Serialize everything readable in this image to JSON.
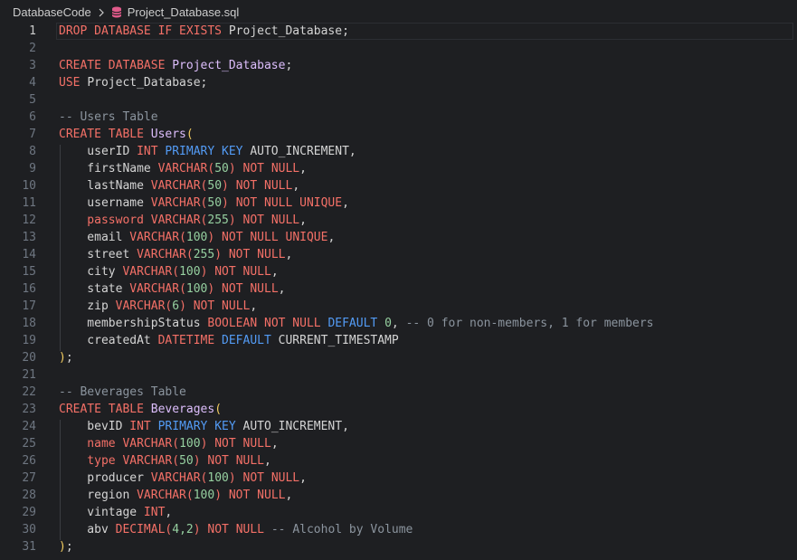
{
  "breadcrumb": {
    "folder": "DatabaseCode",
    "file": "Project_Database.sql",
    "file_icon": "database-icon",
    "separator_icon": "chevron-right-icon"
  },
  "editor": {
    "current_line": 1,
    "lines": [
      {
        "n": "1",
        "t": [
          [
            "kw",
            "DROP DATABASE IF EXISTS "
          ],
          [
            "pl",
            "Project_Database;"
          ]
        ]
      },
      {
        "n": "2",
        "t": []
      },
      {
        "n": "3",
        "t": [
          [
            "kw",
            "CREATE DATABASE "
          ],
          [
            "id",
            "Project_Database"
          ],
          [
            "pl",
            ";"
          ]
        ]
      },
      {
        "n": "4",
        "t": [
          [
            "kw",
            "USE "
          ],
          [
            "pl",
            "Project_Database;"
          ]
        ]
      },
      {
        "n": "5",
        "t": []
      },
      {
        "n": "6",
        "t": [
          [
            "cm",
            "-- Users Table"
          ]
        ]
      },
      {
        "n": "7",
        "t": [
          [
            "kw",
            "CREATE TABLE "
          ],
          [
            "id",
            "Users"
          ],
          [
            "pu",
            "("
          ]
        ]
      },
      {
        "n": "8",
        "t": [
          [
            "pl",
            "    userID "
          ],
          [
            "ty",
            "INT "
          ],
          [
            "bl",
            "PRIMARY KEY "
          ],
          [
            "pl",
            "AUTO_INCREMENT,"
          ]
        ]
      },
      {
        "n": "9",
        "t": [
          [
            "pl",
            "    firstName "
          ],
          [
            "ty",
            "VARCHAR("
          ],
          [
            "nm",
            "50"
          ],
          [
            "ty",
            ") "
          ],
          [
            "kw",
            "NOT NULL"
          ],
          [
            "pl",
            ","
          ]
        ]
      },
      {
        "n": "10",
        "t": [
          [
            "pl",
            "    lastName "
          ],
          [
            "ty",
            "VARCHAR("
          ],
          [
            "nm",
            "50"
          ],
          [
            "ty",
            ") "
          ],
          [
            "kw",
            "NOT NULL"
          ],
          [
            "pl",
            ","
          ]
        ]
      },
      {
        "n": "11",
        "t": [
          [
            "pl",
            "    username "
          ],
          [
            "ty",
            "VARCHAR("
          ],
          [
            "nm",
            "50"
          ],
          [
            "ty",
            ") "
          ],
          [
            "kw",
            "NOT NULL UNIQUE"
          ],
          [
            "pl",
            ","
          ]
        ]
      },
      {
        "n": "12",
        "t": [
          [
            "kw",
            "    password "
          ],
          [
            "ty",
            "VARCHAR("
          ],
          [
            "nm",
            "255"
          ],
          [
            "ty",
            ") "
          ],
          [
            "kw",
            "NOT NULL"
          ],
          [
            "pl",
            ","
          ]
        ]
      },
      {
        "n": "13",
        "t": [
          [
            "pl",
            "    email "
          ],
          [
            "ty",
            "VARCHAR("
          ],
          [
            "nm",
            "100"
          ],
          [
            "ty",
            ") "
          ],
          [
            "kw",
            "NOT NULL UNIQUE"
          ],
          [
            "pl",
            ","
          ]
        ]
      },
      {
        "n": "14",
        "t": [
          [
            "pl",
            "    street "
          ],
          [
            "ty",
            "VARCHAR("
          ],
          [
            "nm",
            "255"
          ],
          [
            "ty",
            ") "
          ],
          [
            "kw",
            "NOT NULL"
          ],
          [
            "pl",
            ","
          ]
        ]
      },
      {
        "n": "15",
        "t": [
          [
            "pl",
            "    city "
          ],
          [
            "ty",
            "VARCHAR("
          ],
          [
            "nm",
            "100"
          ],
          [
            "ty",
            ") "
          ],
          [
            "kw",
            "NOT NULL"
          ],
          [
            "pl",
            ","
          ]
        ]
      },
      {
        "n": "16",
        "t": [
          [
            "pl",
            "    state "
          ],
          [
            "ty",
            "VARCHAR("
          ],
          [
            "nm",
            "100"
          ],
          [
            "ty",
            ") "
          ],
          [
            "kw",
            "NOT NULL"
          ],
          [
            "pl",
            ","
          ]
        ]
      },
      {
        "n": "17",
        "t": [
          [
            "pl",
            "    zip "
          ],
          [
            "ty",
            "VARCHAR("
          ],
          [
            "nm",
            "6"
          ],
          [
            "ty",
            ") "
          ],
          [
            "kw",
            "NOT NULL"
          ],
          [
            "pl",
            ","
          ]
        ]
      },
      {
        "n": "18",
        "t": [
          [
            "pl",
            "    membershipStatus "
          ],
          [
            "ty",
            "BOOLEAN "
          ],
          [
            "kw",
            "NOT NULL "
          ],
          [
            "bl",
            "DEFAULT "
          ],
          [
            "nm",
            "0"
          ],
          [
            "pl",
            ", "
          ],
          [
            "cm",
            "-- 0 for non-members, 1 for members"
          ]
        ]
      },
      {
        "n": "19",
        "t": [
          [
            "pl",
            "    createdAt "
          ],
          [
            "ty",
            "DATETIME "
          ],
          [
            "bl",
            "DEFAULT "
          ],
          [
            "pl",
            "CURRENT_TIMESTAMP"
          ]
        ]
      },
      {
        "n": "20",
        "t": [
          [
            "pu",
            ")"
          ],
          [
            "pl",
            ";"
          ]
        ]
      },
      {
        "n": "21",
        "t": []
      },
      {
        "n": "22",
        "t": [
          [
            "cm",
            "-- Beverages Table"
          ]
        ]
      },
      {
        "n": "23",
        "t": [
          [
            "kw",
            "CREATE TABLE "
          ],
          [
            "id",
            "Beverages"
          ],
          [
            "pu",
            "("
          ]
        ]
      },
      {
        "n": "24",
        "t": [
          [
            "pl",
            "    bevID "
          ],
          [
            "ty",
            "INT "
          ],
          [
            "bl",
            "PRIMARY KEY "
          ],
          [
            "pl",
            "AUTO_INCREMENT,"
          ]
        ]
      },
      {
        "n": "25",
        "t": [
          [
            "kw",
            "    name "
          ],
          [
            "ty",
            "VARCHAR("
          ],
          [
            "nm",
            "100"
          ],
          [
            "ty",
            ") "
          ],
          [
            "kw",
            "NOT NULL"
          ],
          [
            "pl",
            ","
          ]
        ]
      },
      {
        "n": "26",
        "t": [
          [
            "kw",
            "    type "
          ],
          [
            "ty",
            "VARCHAR("
          ],
          [
            "nm",
            "50"
          ],
          [
            "ty",
            ") "
          ],
          [
            "kw",
            "NOT NULL"
          ],
          [
            "pl",
            ","
          ]
        ]
      },
      {
        "n": "27",
        "t": [
          [
            "pl",
            "    producer "
          ],
          [
            "ty",
            "VARCHAR("
          ],
          [
            "nm",
            "100"
          ],
          [
            "ty",
            ") "
          ],
          [
            "kw",
            "NOT NULL"
          ],
          [
            "pl",
            ","
          ]
        ]
      },
      {
        "n": "28",
        "t": [
          [
            "pl",
            "    region "
          ],
          [
            "ty",
            "VARCHAR("
          ],
          [
            "nm",
            "100"
          ],
          [
            "ty",
            ") "
          ],
          [
            "kw",
            "NOT NULL"
          ],
          [
            "pl",
            ","
          ]
        ]
      },
      {
        "n": "29",
        "t": [
          [
            "pl",
            "    vintage "
          ],
          [
            "ty",
            "INT"
          ],
          [
            "pl",
            ","
          ]
        ]
      },
      {
        "n": "30",
        "t": [
          [
            "pl",
            "    abv "
          ],
          [
            "ty",
            "DECIMAL("
          ],
          [
            "nm",
            "4,2"
          ],
          [
            "ty",
            ") "
          ],
          [
            "kw",
            "NOT NULL "
          ],
          [
            "cm",
            "-- Alcohol by Volume"
          ]
        ]
      },
      {
        "n": "31",
        "t": [
          [
            "pu",
            ")"
          ],
          [
            "pl",
            ";"
          ]
        ]
      }
    ]
  }
}
